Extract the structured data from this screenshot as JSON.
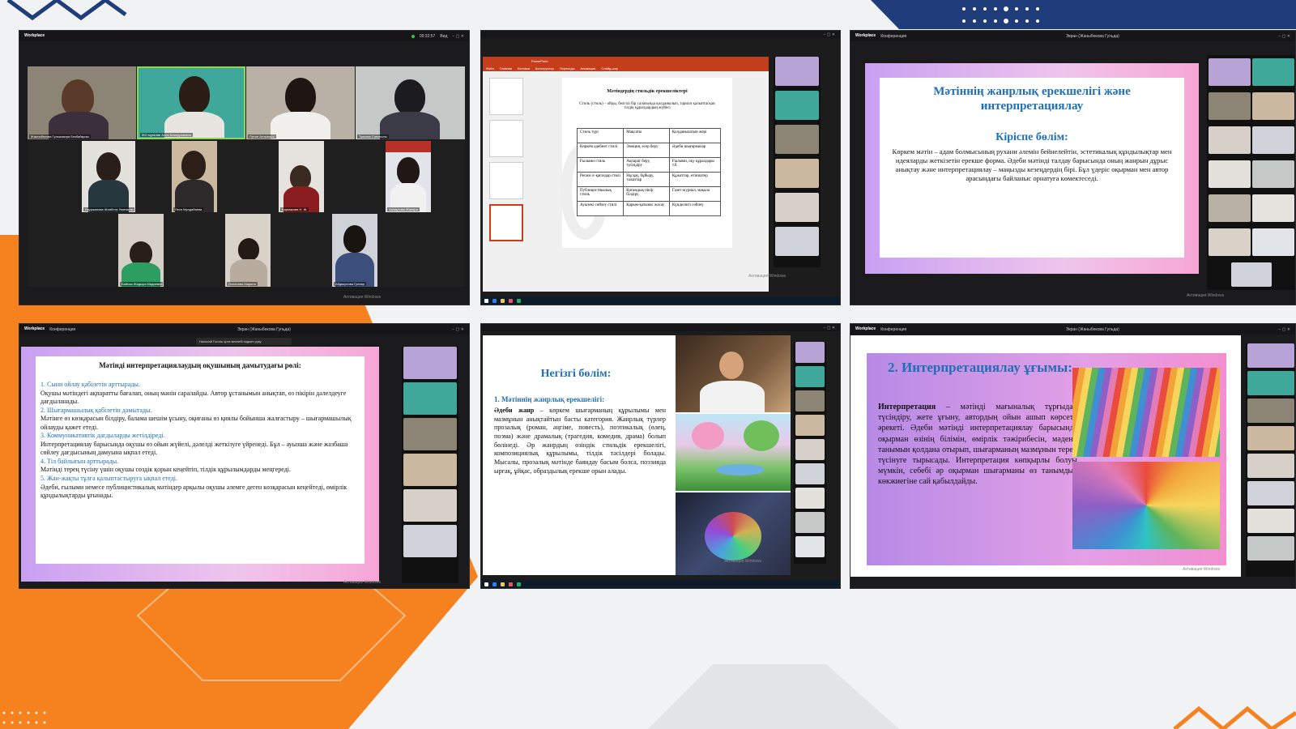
{
  "watermark": "Активация Windows",
  "panels": [
    {
      "app": "Workplace",
      "timer": "00:32:57",
      "view_label": "Вид"
    },
    {
      "doc_title": "PowerPoint",
      "ribbon_tabs": [
        "Файл",
        "Главная",
        "Вставка",
        "Конструктор",
        "Переходы",
        "Анимация",
        "Слайд-шоу"
      ],
      "slide_title": "Мәтіндердің стильдік ерекшеліктері",
      "slide_subtitle": "Стиль (стиль) – ойды, белгілі бір саласында қолданылып, тарихи қалыптасқан тілдік құралдардың жүйесі",
      "table": [
        [
          "Стиль түрі",
          "Мақсаты",
          "Қолданылатын жері"
        ],
        [
          "Көркем әдебиет стилі",
          "Эмоция, әсер беру",
          "Әдеби шығармалар"
        ],
        [
          "Ғылыми стиль",
          "Ақпарат беру, түсіндіру",
          "Ғылыми, оқу құралдары т.б."
        ],
        [
          "Ресми іс-қағаздар стилі",
          "Нұсқау, бұйыру, талаптар",
          "Құжаттар, өтініштер"
        ],
        [
          "Публицистикалық стиль",
          "Қоғамдық пікір білдіру",
          "Газет-журнал, мақала"
        ],
        [
          "Ауызекі сөйлеу стилі",
          "Қарым-қатынас жасау",
          "Күнделікті сөйлеу"
        ]
      ]
    },
    {
      "conference": "Конференция",
      "share": "Экран (Жаныбекова Гульда)",
      "title": "Мәтіннің жанрлық ерекшелігі және интерпретациялау",
      "subheading": "Кіріспе бөлім:",
      "body": "Көркем мәтін – адам болмысының рухани әлемін бейнелейтін, эстетикалық құндылықтар мен идеяларды жеткізетін ерекше форма. Әдеби мәтінді талдау барысында оның жанрын дұрыс анықтау және интерпретациялау – маңызды кезеңдердің бірі. Бұл үдеріс оқырман мен автор арасындағы байланыс орнатуға көмектеседі."
    },
    {
      "notification": "Николай Гоголь орта мектебі подает руку",
      "title": "Мәтінді интерпретациялаудың оқушының дамытудағы рөлі:",
      "items": [
        {
          "heading": "1. Сыни ойлау қабілетін арттырады.",
          "text": "Оқушы мәтіндегі ақпаратты бағалап, оның мәнін саралайды. Автор ұстанымын анықтап, өз пікірін дәлелдеуге дағдыланады."
        },
        {
          "heading": "2. Шығармашылық қабілетін дамытады.",
          "text": "Мәтінге өз көзқарасын білдіру, балама шешім ұсыну, оқиғаны өз қиялы бойынша жалғастыру – шығармашылық ойлауды қажет етеді."
        },
        {
          "heading": "3. Коммуникативтік дағдыларды жетілдіреді.",
          "text": "Интерпретациялау барысында оқушы өз ойын жүйелі, дәлелді жеткізуге үйренеді. Бұл – ауызша және жазбаша сөйлеу дағдысының дамуына ықпал етеді."
        },
        {
          "heading": "4. Тіл байлығын арттырады.",
          "text": "Мәтінді терең түсіну үшін оқушы сөздік қорын кеңейтіп, тілдік құрылымдарды меңгереді."
        },
        {
          "heading": "5. Жан-жақты тұлға қалыптастыруға ықпал етеді.",
          "text": "Әдеби, ғылыми немесе публицистикалық мәтіндер арқылы оқушы әлемге деген көзқарасын кеңейтеді, өмірлік құндылықтарды ұғынады."
        }
      ]
    },
    {
      "title": "Негізгі бөлім:",
      "subheading": "1. Мәтіннің жанрлық ерекшелігі:",
      "term": "Әдеби жанр",
      "body": " – көркем шығарманың құрылымы мен мазмұнын анықтайтын басты категория. Жанрлық түрлер прозалық (роман, әңгіме, повесть), поэтикалық (өлең, поэма) және драмалық (трагедия, комедия, драма) болып бөлінеді. Әр жанрдың өзіндік стильдік ерекшелігі, композициялық құрылымы, тілдік тәсілдері болады. Мысалы, прозалық мәтінде баяндау басым болса, поэзияда ырғақ, ұйқас, образдылық ерекше орын алады."
    },
    {
      "title": "2. Интерпретациялау ұғымы:",
      "term": "Интерпретация",
      "body": " – мәтінді мағыналық тұрғыдан түсіндіру, жете ұғыну, автордың ойын ашып көрсету әрекеті. Әдеби мәтінді интерпретациялау барысында оқырман өзінің білімін, өмірлік тәжірибесін, мәдени танымын қолдана отырып, шығарманың мазмұнын терең түсінуге тырысады. Интерпретация көпқырлы болуы мүмкін, себебі әр оқырман шығарманы өз танымдық көкжиегіне сай қабылдайды."
    }
  ],
  "participants": [
    "Жаксыбекова Гульжазира Бекбайқызы",
    "ЖО мұғалімі Алия Бекмурзаевна",
    "Путан Алтынкыз",
    "Туякова Самиголы",
    "Бауржанова Жанбота Умиткызы",
    "Леся Мулдабаева",
    "Бармакова Н. Ж.",
    "Азимутова Жанара",
    "Байсык Жадыра Мадиевна",
    "Оспанова Марина",
    "Абдикулова Гулнар"
  ]
}
